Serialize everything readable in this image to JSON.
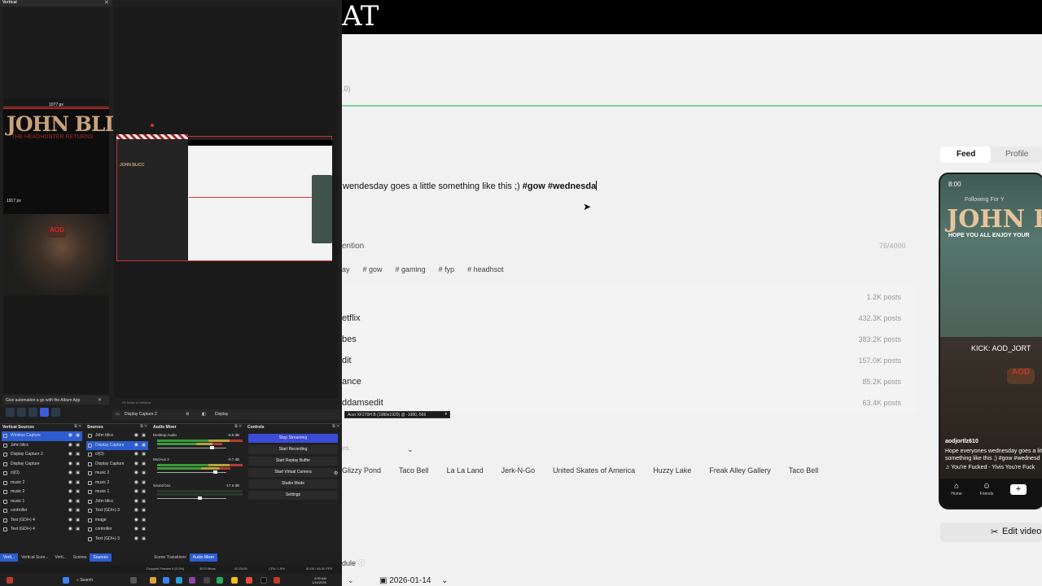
{
  "web": {
    "logo": "AT",
    "caption": "wendesday goes a little something like this ;)",
    "caption_tags": "#gow #wednesda",
    "mention_label": "ention",
    "char_count": "76/4000",
    "hashtag_chips": [
      "ay",
      "# gow",
      "# gaming",
      "# fyp",
      "# headhsot"
    ],
    "tag_suggestions": [
      {
        "name": "",
        "posts": "1.2K posts"
      },
      {
        "name": "etflix",
        "posts": "432.3K posts"
      },
      {
        "name": "bes",
        "posts": "383.2K posts"
      },
      {
        "name": "dit",
        "posts": "157.0K posts"
      },
      {
        "name": "ance",
        "posts": "85.2K posts"
      },
      {
        "name": "ddamsedit",
        "posts": "63.4K posts"
      }
    ],
    "location_placeholder": "es",
    "location_chips": [
      "Glizzy Pond",
      "Taco Bell",
      "La La Land",
      "Jerk-N-Go",
      "United Skates of America",
      "Huzzy Lake",
      "Freak Alley Gallery",
      "Taco Bell"
    ],
    "schedule_label": "dule",
    "date": "2026-01-14",
    "feed_tab": "Feed",
    "profile_tab": "Profile",
    "edit_video": "Edit video",
    "phone": {
      "time": "8:00",
      "following": "Following  For Y",
      "title": "JOHN BL",
      "subtitle": "HE HEADHUNTER RE",
      "hope": "HOPE YOU ALL ENJOY YOUR",
      "kick": "KICK: AOD_JORT",
      "aod": "AOD",
      "username": "aodjortlz610",
      "desc_1": "Hope everyones wednesday goes a littl",
      "desc_2": "something like this ;) #gow #wednesd",
      "music": "♫  You're Fucked - Yivis     You're Fuck",
      "nav_home": "Home",
      "nav_friends": "Friends"
    }
  },
  "obs": {
    "vertical_title": "Vertical",
    "px_top": "1077 px",
    "px_left": "1917 px",
    "vertical_jb_title": "JOHN BLICC",
    "vertical_jb_sub": "THE HEADHUNTER RETURNS",
    "vertical_aod": "AOD",
    "banner": "Give automation a go with the Album App",
    "preview_toolbar": "Fit     Scale to Window",
    "props_source": "Display Capture 2",
    "props_display_label": "Display",
    "props_display_value": "Acer XF270H B (1080x1920) @ -1080,-566",
    "vertical_sources_title": "Vertical Sources",
    "vertical_sources": [
      "Window Capture",
      "John blicc",
      "Display Capture 2",
      "Display Capture",
      "cl(O)",
      "music 2",
      "music 2",
      "music 1",
      "controller",
      "Text (GDI+) 4",
      "Text (GDI+) 4"
    ],
    "sources_title": "Sources",
    "sources": [
      "John blicc",
      "Display Capture",
      "cl(O)",
      "Display Capture",
      "music 2",
      "music 2",
      "music 1",
      "John blicc",
      "Text (GDI+) 3",
      "image",
      "controller",
      "Text (GDI+) 3"
    ],
    "mixer_title": "Audio Mixer",
    "mixer": [
      {
        "name": "Desktop Audio",
        "db": "-5.9 dB"
      },
      {
        "name": "Mic/Aux 2",
        "db": "-0.7 dB"
      },
      {
        "name": "Sound box",
        "db": "-17.6 dB"
      }
    ],
    "controls_title": "Controls",
    "controls": [
      "Stop Streaming",
      "Start Recording",
      "Start Replay Buffer",
      "Start Virtual Camera",
      "Studio Mode",
      "Settings"
    ],
    "tabs_left": [
      "Verti...",
      "Vertical Scen...",
      "Verti...",
      "Scenes",
      "Sources"
    ],
    "tabs_mid": [
      "Scene Transitions",
      "Audio Mixer"
    ],
    "status": {
      "dropped": "Dropped Frames 0 (0.0%)",
      "bitrate": "3570 Mbps",
      "time": "02:25:05",
      "cpu": "CPU: 1.5%",
      "fps": "60.00 / 60.00 FPS"
    }
  },
  "taskbar": {
    "search": "Search",
    "clock_time": "4:00 AM",
    "clock_date": "1/14/2026"
  }
}
